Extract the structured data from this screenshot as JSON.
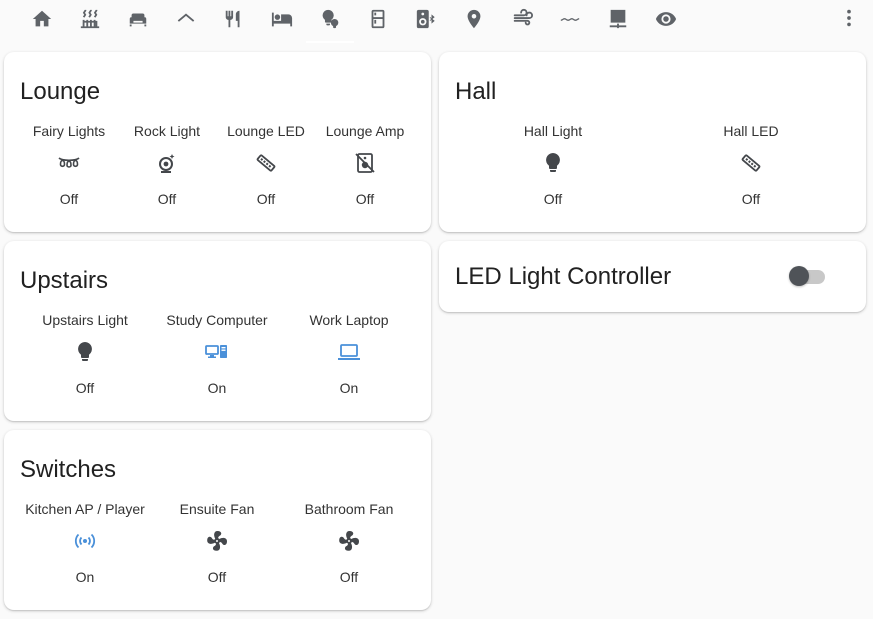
{
  "nav": {
    "tabs": [
      {
        "icon": "home-icon"
      },
      {
        "icon": "radiator-icon"
      },
      {
        "icon": "sofa-icon"
      },
      {
        "icon": "roof-icon"
      },
      {
        "icon": "silverware-icon"
      },
      {
        "icon": "bed-icon"
      },
      {
        "icon": "lightbulb-group-icon",
        "active": true
      },
      {
        "icon": "fridge-icon"
      },
      {
        "icon": "speaker-bluetooth-icon"
      },
      {
        "icon": "map-marker-icon"
      },
      {
        "icon": "weather-windy-icon"
      },
      {
        "icon": "water-icon"
      },
      {
        "icon": "server-network-icon"
      },
      {
        "icon": "eye-icon"
      }
    ],
    "menu_icon": "dots-vertical-icon"
  },
  "colors": {
    "icon_off": "#44474b",
    "icon_on": "#4a90d9",
    "background": "#fafafa",
    "card": "#ffffff"
  },
  "lounge": {
    "title": "Lounge",
    "entities": [
      {
        "name": "Fairy Lights",
        "state": "Off",
        "icon": "string-lights-icon"
      },
      {
        "name": "Rock Light",
        "state": "Off",
        "icon": "lamp-icon"
      },
      {
        "name": "Lounge LED",
        "state": "Off",
        "icon": "led-strip-icon"
      },
      {
        "name": "Lounge Amp",
        "state": "Off",
        "icon": "speaker-off-icon"
      }
    ]
  },
  "hall": {
    "title": "Hall",
    "entities": [
      {
        "name": "Hall Light",
        "state": "Off",
        "icon": "lightbulb-icon"
      },
      {
        "name": "Hall LED",
        "state": "Off",
        "icon": "led-strip-icon"
      }
    ]
  },
  "upstairs": {
    "title": "Upstairs",
    "entities": [
      {
        "name": "Upstairs Light",
        "state": "Off",
        "icon": "lightbulb-icon"
      },
      {
        "name": "Study Computer",
        "state": "On",
        "icon": "desktop-tower-monitor-icon"
      },
      {
        "name": "Work Laptop",
        "state": "On",
        "icon": "laptop-icon"
      }
    ]
  },
  "led_controller": {
    "title": "LED Light Controller",
    "toggle_on": false
  },
  "switches": {
    "title": "Switches",
    "entities": [
      {
        "name": "Kitchen AP / Player",
        "state": "On",
        "icon": "access-point-icon"
      },
      {
        "name": "Ensuite Fan",
        "state": "Off",
        "icon": "fan-icon"
      },
      {
        "name": "Bathroom Fan",
        "state": "Off",
        "icon": "fan-icon"
      }
    ]
  }
}
